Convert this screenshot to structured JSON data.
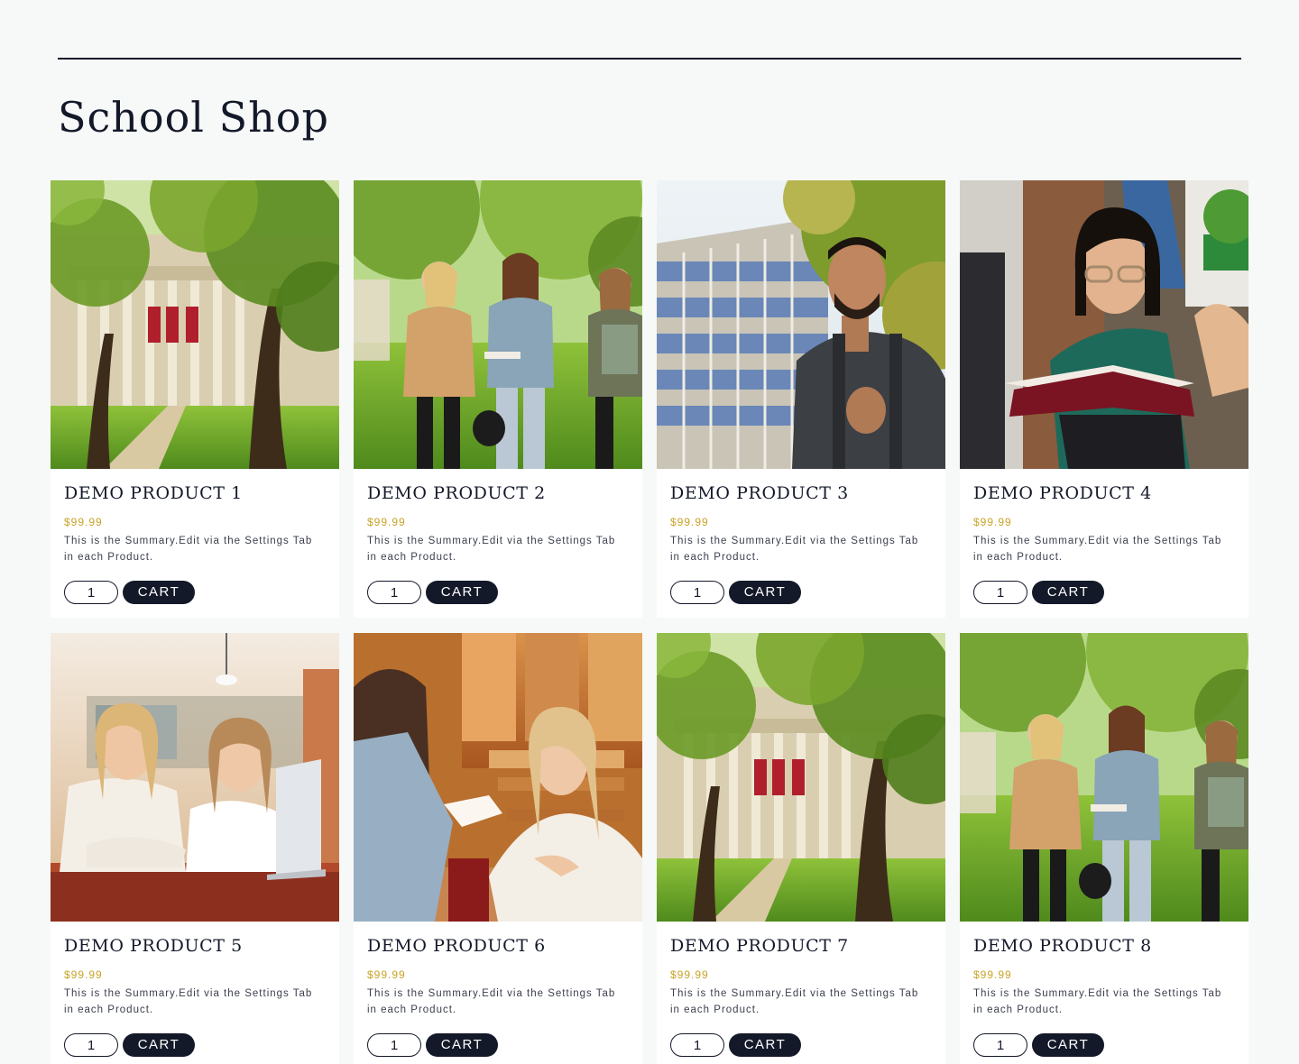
{
  "page": {
    "title": "School Shop"
  },
  "colors": {
    "ink": "#14192a",
    "price": "#c9a227",
    "background": "#f7f9f8"
  },
  "products": [
    {
      "name": "DEMO PRODUCT 1",
      "price": "$99.99",
      "summary": "This is the Summary.Edit via the Settings Tab in each Product.",
      "qty": "1",
      "cart_label": "CART",
      "photo": "campus-building-photo"
    },
    {
      "name": "DEMO PRODUCT 2",
      "price": "$99.99",
      "summary": "This is the Summary.Edit via the Settings Tab in each Product.",
      "qty": "1",
      "cart_label": "CART",
      "photo": "students-walking-photo"
    },
    {
      "name": "DEMO PRODUCT 3",
      "price": "$99.99",
      "summary": "This is the Summary.Edit via the Settings Tab in each Product.",
      "qty": "1",
      "cart_label": "CART",
      "photo": "student-backpack-photo"
    },
    {
      "name": "DEMO PRODUCT 4",
      "price": "$99.99",
      "summary": "This is the Summary.Edit via the Settings Tab in each Product.",
      "qty": "1",
      "cart_label": "CART",
      "photo": "student-reading-photo"
    },
    {
      "name": "DEMO PRODUCT 5",
      "price": "$99.99",
      "summary": "This is the Summary.Edit via the Settings Tab in each Product.",
      "qty": "1",
      "cart_label": "CART",
      "photo": "students-laptop-photo"
    },
    {
      "name": "DEMO PRODUCT 6",
      "price": "$99.99",
      "summary": "This is the Summary.Edit via the Settings Tab in each Product.",
      "qty": "1",
      "cart_label": "CART",
      "photo": "classroom-writing-photo"
    },
    {
      "name": "DEMO PRODUCT 7",
      "price": "$99.99",
      "summary": "This is the Summary.Edit via the Settings Tab in each Product.",
      "qty": "1",
      "cart_label": "CART",
      "photo": "campus-building-photo"
    },
    {
      "name": "DEMO PRODUCT 8",
      "price": "$99.99",
      "summary": "This is the Summary.Edit via the Settings Tab in each Product.",
      "qty": "1",
      "cart_label": "CART",
      "photo": "students-walking-photo"
    }
  ]
}
